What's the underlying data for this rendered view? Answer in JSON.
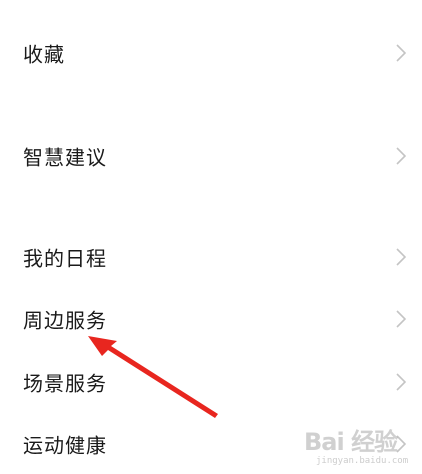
{
  "menu": {
    "items": [
      {
        "label": "收藏"
      },
      {
        "label": "智慧建议"
      },
      {
        "label": "我的日程"
      },
      {
        "label": "周边服务"
      },
      {
        "label": "场景服务"
      },
      {
        "label": "运动健康"
      }
    ]
  },
  "watermark": {
    "brand": "Bai 经验",
    "url": "jingyan.baidu.com"
  },
  "colors": {
    "arrow": "#e8261f",
    "chevron": "#c4c4c4",
    "text": "#1a1a1a"
  }
}
